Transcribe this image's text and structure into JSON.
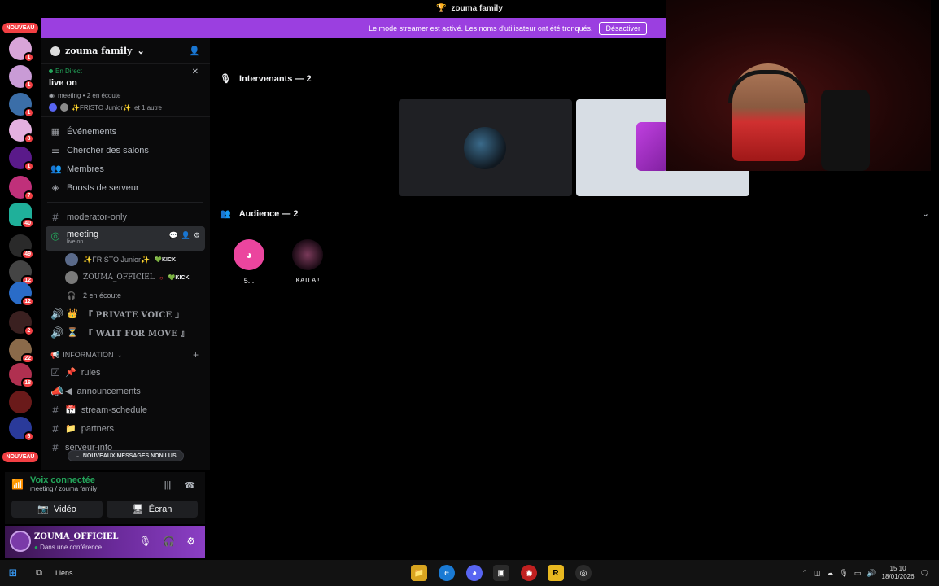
{
  "window": {
    "title": "zouma family"
  },
  "banner": {
    "message": "Le mode streamer est activé. Les noms d'utilisateur ont été tronqués.",
    "button": "Désactiver"
  },
  "rail": {
    "nouveau_top": "NOUVEAU",
    "nouveau_bottom": "NOUVEAU",
    "badges": [
      "1",
      "1",
      "1",
      "8",
      "1",
      "7",
      "40",
      "49",
      "12",
      "12",
      "2",
      "22",
      "18",
      "",
      "6"
    ]
  },
  "server": {
    "name": "zouma family"
  },
  "live": {
    "status": "En Direct",
    "title": "live on",
    "meta": "meeting • 2 en écoute",
    "users": "✨FRISTO Junior✨",
    "others": "et 1 autre"
  },
  "nav": [
    {
      "label": "Événements"
    },
    {
      "label": "Chercher des salons"
    },
    {
      "label": "Membres"
    },
    {
      "label": "Boosts de serveur"
    }
  ],
  "channels": {
    "moderator": "moderator-only",
    "meeting": "meeting",
    "meeting_sub": "live on",
    "voice_users": [
      {
        "name": "✨FRISTO Junior✨",
        "tag": "KICK"
      },
      {
        "name": "ZOUMA_OFFICIEL",
        "tag": "KICK"
      }
    ],
    "listening": "2 en écoute",
    "private_voice": "『 PRIVATE VOICE 』",
    "wait_for_move": "『 WAIT FOR MOVE 』",
    "category": "INFORMATION",
    "info_channels": [
      "rules",
      "announcements",
      "stream-schedule",
      "partners",
      "serveur-info"
    ],
    "unread_pill": "NOUVEAUX MESSAGES NON LUS"
  },
  "voice": {
    "status": "Voix connectée",
    "location": "meeting / zouma family",
    "video": "Vidéo",
    "screen": "Écran"
  },
  "user": {
    "name": "ZOUMA_OFFICIEL",
    "status": "Dans une conférence"
  },
  "stage": {
    "speakers": "Intervenants — 2",
    "audience": "Audience — 2",
    "audience_members": [
      "5...",
      "KATLA !"
    ]
  },
  "taskbar": {
    "liens": "Liens",
    "time": "15:10",
    "date": "18/01/2026"
  }
}
